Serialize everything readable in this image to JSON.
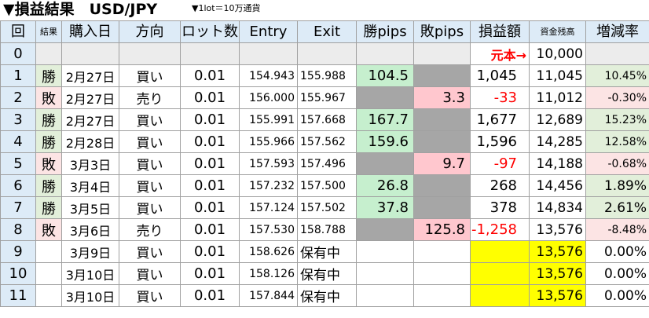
{
  "title": {
    "main": "▼損益結果　USD/JPY",
    "note": "▼1lot＝10万通貨"
  },
  "headers": {
    "num": "回",
    "result": "結果",
    "date": "購入日",
    "direction": "方向",
    "lots": "ロット数",
    "entry": "Entry",
    "exit": "Exit",
    "win_pips": "勝pips",
    "lose_pips": "敗pips",
    "pl": "損益額",
    "balance": "資金残高",
    "rate": "増減率"
  },
  "row0": {
    "num": "0",
    "pl": "元本→",
    "balance": "10,000"
  },
  "rows": [
    {
      "num": "1",
      "result": "勝",
      "date": "2月27日",
      "direction": "買い",
      "lots": "0.01",
      "entry": "154.943",
      "exit": "155.988",
      "win_pips": "104.5",
      "lose_pips": "",
      "pl": "1,045",
      "balance": "11,045",
      "rate": "10.45%"
    },
    {
      "num": "2",
      "result": "敗",
      "date": "2月27日",
      "direction": "売り",
      "lots": "0.01",
      "entry": "156.000",
      "exit": "155.967",
      "win_pips": "",
      "lose_pips": "3.3",
      "pl": "-33",
      "balance": "11,012",
      "rate": "-0.30%"
    },
    {
      "num": "3",
      "result": "勝",
      "date": "2月27日",
      "direction": "買い",
      "lots": "0.01",
      "entry": "155.991",
      "exit": "157.668",
      "win_pips": "167.7",
      "lose_pips": "",
      "pl": "1,677",
      "balance": "12,689",
      "rate": "15.23%"
    },
    {
      "num": "4",
      "result": "勝",
      "date": "2月28日",
      "direction": "買い",
      "lots": "0.01",
      "entry": "155.966",
      "exit": "157.562",
      "win_pips": "159.6",
      "lose_pips": "",
      "pl": "1,596",
      "balance": "14,285",
      "rate": "12.58%"
    },
    {
      "num": "5",
      "result": "敗",
      "date": "3月3日",
      "direction": "買い",
      "lots": "0.01",
      "entry": "157.593",
      "exit": "157.496",
      "win_pips": "",
      "lose_pips": "9.7",
      "pl": "-97",
      "balance": "14,188",
      "rate": "-0.68%"
    },
    {
      "num": "6",
      "result": "勝",
      "date": "3月4日",
      "direction": "買い",
      "lots": "0.01",
      "entry": "157.232",
      "exit": "157.500",
      "win_pips": "26.8",
      "lose_pips": "",
      "pl": "268",
      "balance": "14,456",
      "rate": "1.89%"
    },
    {
      "num": "7",
      "result": "勝",
      "date": "3月5日",
      "direction": "買い",
      "lots": "0.01",
      "entry": "157.124",
      "exit": "157.502",
      "win_pips": "37.8",
      "lose_pips": "",
      "pl": "378",
      "balance": "14,834",
      "rate": "2.61%"
    },
    {
      "num": "8",
      "result": "敗",
      "date": "3月6日",
      "direction": "売り",
      "lots": "0.01",
      "entry": "157.530",
      "exit": "158.788",
      "win_pips": "",
      "lose_pips": "125.8",
      "pl": "-1,258",
      "balance": "13,576",
      "rate": "-8.48%"
    },
    {
      "num": "9",
      "result": "",
      "date": "3月9日",
      "direction": "買い",
      "lots": "0.01",
      "entry": "158.626",
      "exit": "保有中",
      "win_pips": "",
      "lose_pips": "",
      "pl": "",
      "balance": "13,576",
      "rate": "0.00%"
    },
    {
      "num": "10",
      "result": "",
      "date": "3月10日",
      "direction": "買い",
      "lots": "0.01",
      "entry": "158.126",
      "exit": "保有中",
      "win_pips": "",
      "lose_pips": "",
      "pl": "",
      "balance": "13,576",
      "rate": "0.00%"
    },
    {
      "num": "11",
      "result": "",
      "date": "3月10日",
      "direction": "買い",
      "lots": "0.01",
      "entry": "157.844",
      "exit": "保有中",
      "win_pips": "",
      "lose_pips": "",
      "pl": "",
      "balance": "13,576",
      "rate": "0.00%"
    }
  ]
}
